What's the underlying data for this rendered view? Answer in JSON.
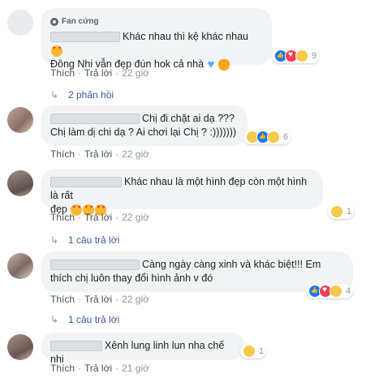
{
  "comments": [
    {
      "badge": "Fan cứng",
      "text_line1": "Khác nhau thì kệ khác nhau",
      "text_line2": "Đông Nhi vẫn đẹp đún hok cả nhà",
      "reaction_count": "9",
      "like": "Thích",
      "reply": "Trả lời",
      "time": "22 giờ",
      "replies": "2 phản hồi"
    },
    {
      "text_line1": "Chị đi chặt ai dạ ???",
      "text_line2": "Chị làm dị chi dạ ? Ai chơi lại Chị ? :)))))))",
      "reaction_count": "6",
      "like": "Thích",
      "reply": "Trả lời",
      "time": "22 giờ"
    },
    {
      "text_line1": "Khác nhau là một hình đẹp còn một hình là rất",
      "text_line2": "đẹp",
      "reaction_count": "1",
      "like": "Thích",
      "reply": "Trả lời",
      "time": "22 giờ",
      "replies": "1 câu trả lời"
    },
    {
      "text_line1": "Càng ngày càng xinh và khác biệt!!! Em",
      "text_line2": "thích chị luôn thay đổi hình ảnh v đó",
      "reaction_count": "4",
      "like": "Thích",
      "reply": "Trả lời",
      "time": "22 giờ",
      "replies": "1 câu trả lời"
    },
    {
      "text_line1": "Xênh lung linh lun nha chế nhi",
      "reaction_count": "1",
      "like": "Thích",
      "reply": "Trả lời",
      "time": "21 giờ"
    }
  ],
  "separator": "·",
  "colors": {
    "bubble": "#f2f3f5",
    "link": "#385898",
    "meta": "#90949c"
  }
}
